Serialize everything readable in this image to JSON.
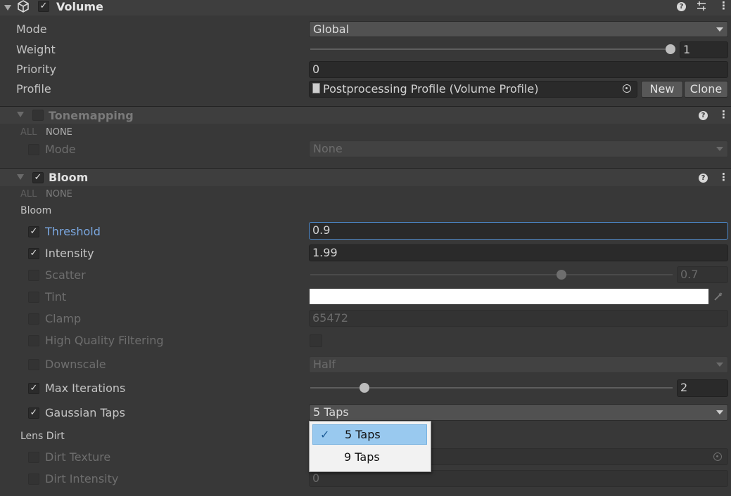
{
  "volume": {
    "title": "Volume",
    "enabled": true,
    "mode_label": "Mode",
    "mode_value": "Global",
    "weight_label": "Weight",
    "weight_value": "1",
    "weight_fraction": 1.0,
    "priority_label": "Priority",
    "priority_value": "0",
    "profile_label": "Profile",
    "profile_value": "Postprocessing Profile (Volume Profile)",
    "new_button": "New",
    "clone_button": "Clone"
  },
  "tonemapping": {
    "title": "Tonemapping",
    "enabled": false,
    "all": "ALL",
    "none": "NONE",
    "mode_label": "Mode",
    "mode_value": "None"
  },
  "bloom": {
    "title": "Bloom",
    "enabled": true,
    "all": "ALL",
    "none": "NONE",
    "section_bloom": "Bloom",
    "threshold_label": "Threshold",
    "threshold_value": "0.9",
    "intensity_label": "Intensity",
    "intensity_value": "1.99",
    "scatter_label": "Scatter",
    "scatter_value": "0.7",
    "scatter_fraction": 0.7,
    "tint_label": "Tint",
    "tint_color": "#ffffff",
    "clamp_label": "Clamp",
    "clamp_value": "65472",
    "hqf_label": "High Quality Filtering",
    "downscale_label": "Downscale",
    "downscale_value": "Half",
    "max_iter_label": "Max Iterations",
    "max_iter_value": "2",
    "max_iter_fraction": 0.15,
    "gauss_label": "Gaussian Taps",
    "gauss_value": "5 Taps",
    "section_lens": "Lens Dirt",
    "dirt_texture_label": "Dirt Texture",
    "dirt_intensity_label": "Dirt Intensity",
    "dirt_intensity_value": "0"
  },
  "dropdown_menu": {
    "options": [
      "5 Taps",
      "9 Taps"
    ],
    "selected": "5 Taps"
  },
  "icons": {
    "collapse": "triangle-down-icon",
    "component": "cube-icon",
    "help": "help-icon",
    "presets": "sliders-icon",
    "more": "more-vertical-icon",
    "object_picker": "object-picker-icon",
    "eyedropper": "eyedropper-icon",
    "checkmark": "checkmark-icon"
  }
}
